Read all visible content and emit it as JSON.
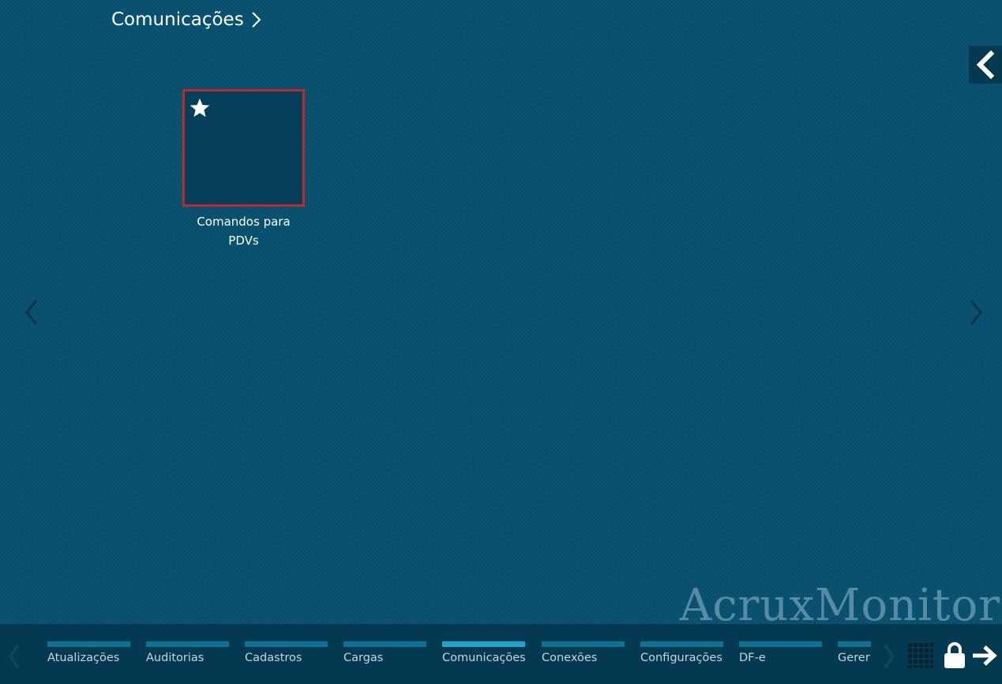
{
  "breadcrumb": {
    "title": "Comunicações",
    "chevron_icon": "chevron-right-icon"
  },
  "tile": {
    "label": "Comandos para PDVs",
    "favorite_icon": "star-icon",
    "selected_border_color": "#c1272d"
  },
  "collapse_button": {
    "icon": "chevron-left-icon"
  },
  "navigation": {
    "prev_icon": "chevron-left-icon",
    "next_icon": "chevron-right-icon"
  },
  "brand": {
    "text": "AcruxMonitor"
  },
  "taskbar": {
    "tabs": [
      {
        "label": "Atualizações",
        "active": false
      },
      {
        "label": "Auditorias",
        "active": false
      },
      {
        "label": "Cadastros",
        "active": false
      },
      {
        "label": "Cargas",
        "active": false
      },
      {
        "label": "Comunicações",
        "active": true
      },
      {
        "label": "Conexões",
        "active": false
      },
      {
        "label": "Configurações",
        "active": false
      },
      {
        "label": "DF-e",
        "active": false
      },
      {
        "label": "Gerer",
        "active": false
      }
    ],
    "icons": [
      "grid-icon",
      "lock-icon",
      "arrow-right-icon"
    ]
  },
  "colors": {
    "background": "#07516f",
    "taskbar": "#033a52",
    "tab_bar": "#0b7396",
    "tab_bar_active": "#1ea7cd"
  }
}
